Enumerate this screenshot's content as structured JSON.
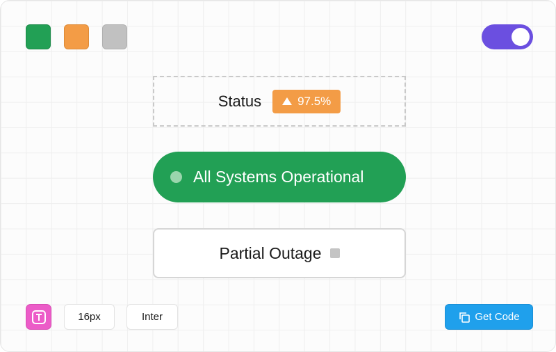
{
  "colors": {
    "green": "#22a055",
    "orange": "#f39c46",
    "gray": "#c1c1c1",
    "toggle": "#6b4fe0",
    "magenta": "#ec5cc8",
    "blue": "#1fa0ec"
  },
  "palette": {
    "swatches": [
      {
        "name": "green",
        "color": "#22a055"
      },
      {
        "name": "orange",
        "color": "#f39c46"
      },
      {
        "name": "gray",
        "color": "#c1c1c1"
      }
    ]
  },
  "toggle": {
    "state": "on",
    "icon": "toggle-icon"
  },
  "status": {
    "label": "Status",
    "badge_value": "97.5%",
    "badge_icon": "triangle-up-icon"
  },
  "operational": {
    "label": "All Systems Operational",
    "icon": "status-dot-icon"
  },
  "outage": {
    "label": "Partial Outage",
    "icon": "gray-square-icon"
  },
  "toolbar": {
    "type_icon": "text-type-icon",
    "font_size": "16px",
    "font_family": "Inter",
    "get_code_label": "Get Code",
    "get_code_icon": "copy-icon"
  }
}
